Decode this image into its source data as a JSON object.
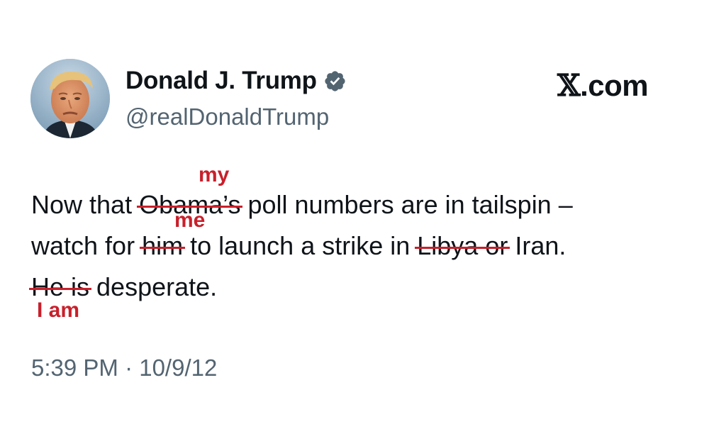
{
  "author": {
    "display_name": "Donald J. Trump",
    "handle": "@realDonaldTrump",
    "verified": true,
    "verified_color": "#536471"
  },
  "brand": {
    "x_mark": "𝕏",
    "domain": ".com"
  },
  "tweet": {
    "line1": {
      "pre": "Now that ",
      "struck": "Obama’s",
      "post": " poll numbers are in tailspin –"
    },
    "line2": {
      "pre": "watch for ",
      "struck1": "him",
      "mid": " to launch a strike in ",
      "struck2": "Libya or",
      "post": " Iran."
    },
    "line3": {
      "struck": "He is",
      "post": " desperate."
    }
  },
  "corrections": {
    "my": "my",
    "me": "me",
    "i_am": "I am",
    "color": "#c8202b"
  },
  "timestamp": "5:39 PM · 10/9/12"
}
